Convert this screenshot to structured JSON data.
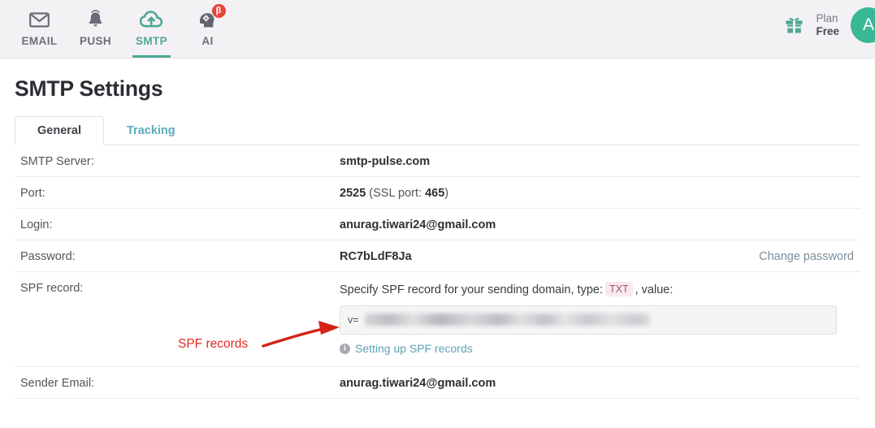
{
  "header": {
    "nav_items": [
      {
        "label": "EMAIL",
        "icon": "envelope-icon",
        "active": false,
        "badge": ""
      },
      {
        "label": "PUSH",
        "icon": "bell-icon",
        "active": false,
        "badge": ""
      },
      {
        "label": "SMTP",
        "icon": "cloud-upload-icon",
        "active": true,
        "badge": ""
      },
      {
        "label": "AI",
        "icon": "ai-head-gear-icon",
        "active": false,
        "badge": "β"
      }
    ],
    "gift_icon": "gift-icon",
    "plan_label": "Plan",
    "plan_value": "Free",
    "avatar_initial": "A",
    "colors": {
      "accent_teal": "#4fa893",
      "avatar_green": "#3ab795",
      "badge_red": "#e5453c",
      "header_bg": "#f4f1f5"
    }
  },
  "page": {
    "title": "SMTP Settings",
    "tabs": [
      {
        "label": "General",
        "active": true
      },
      {
        "label": "Tracking",
        "active": false
      }
    ]
  },
  "settings": {
    "rows": [
      {
        "label": "SMTP Server:",
        "value": "smtp-pulse.com"
      },
      {
        "label": "Port:",
        "value": "2525",
        "suffix_muted": " (SSL port: ",
        "suffix_bold": "465",
        "suffix_end": ")"
      },
      {
        "label": "Login:",
        "value": "anurag.tiwari24@gmail.com"
      },
      {
        "label": "Password:",
        "value": "RC7bLdF8Ja",
        "action_link": "Change password"
      }
    ],
    "spf": {
      "label": "SPF record:",
      "description_before": "Specify SPF record for your sending domain, type:",
      "type_badge": "TXT",
      "description_after": ", value:",
      "input_value": "v=",
      "input_redacted": true,
      "help_link": "Setting up SPF records",
      "help_icon": "info-icon"
    },
    "sender": {
      "label": "Sender Email:",
      "value": "anurag.tiwari24@gmail.com"
    }
  },
  "annotation": {
    "text": "SPF records",
    "color": "#e12a1d",
    "arrow_icon": "red-arrow-right-icon"
  }
}
